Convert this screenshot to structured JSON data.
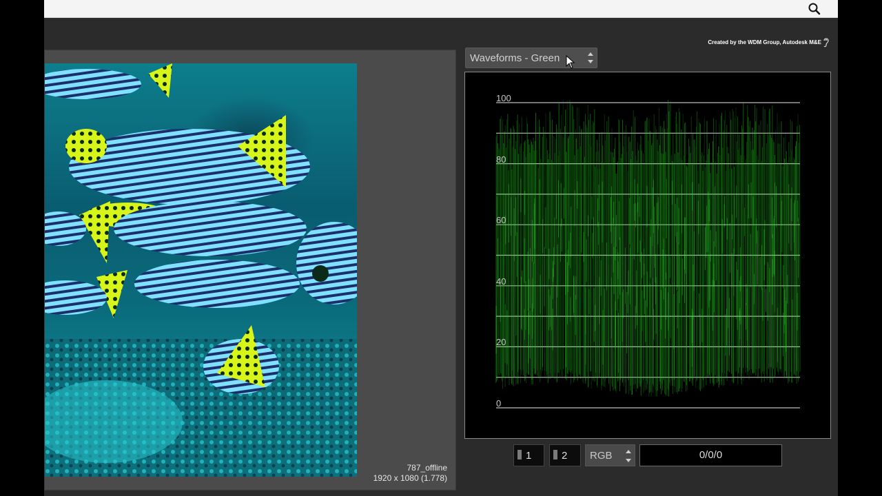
{
  "header": {
    "search_icon": "search-icon"
  },
  "credit": {
    "text": "Created by the WDM Group, Autodesk M&E",
    "icon": "ear-icon"
  },
  "viewer": {
    "clip_name": "787_offline",
    "clip_resolution": "1920 x 1080 (1.778)"
  },
  "scope_selector": {
    "label": "Waveforms - Green"
  },
  "waveform": {
    "channel": "Green",
    "color": "#22c81e",
    "scale_labels": [
      "100",
      "80",
      "60",
      "40",
      "20",
      "0"
    ],
    "range": [
      0,
      100
    ]
  },
  "controls": {
    "ref1_label": "1",
    "ref2_label": "2",
    "mode_label": "RGB",
    "readout": "0/0/0"
  }
}
